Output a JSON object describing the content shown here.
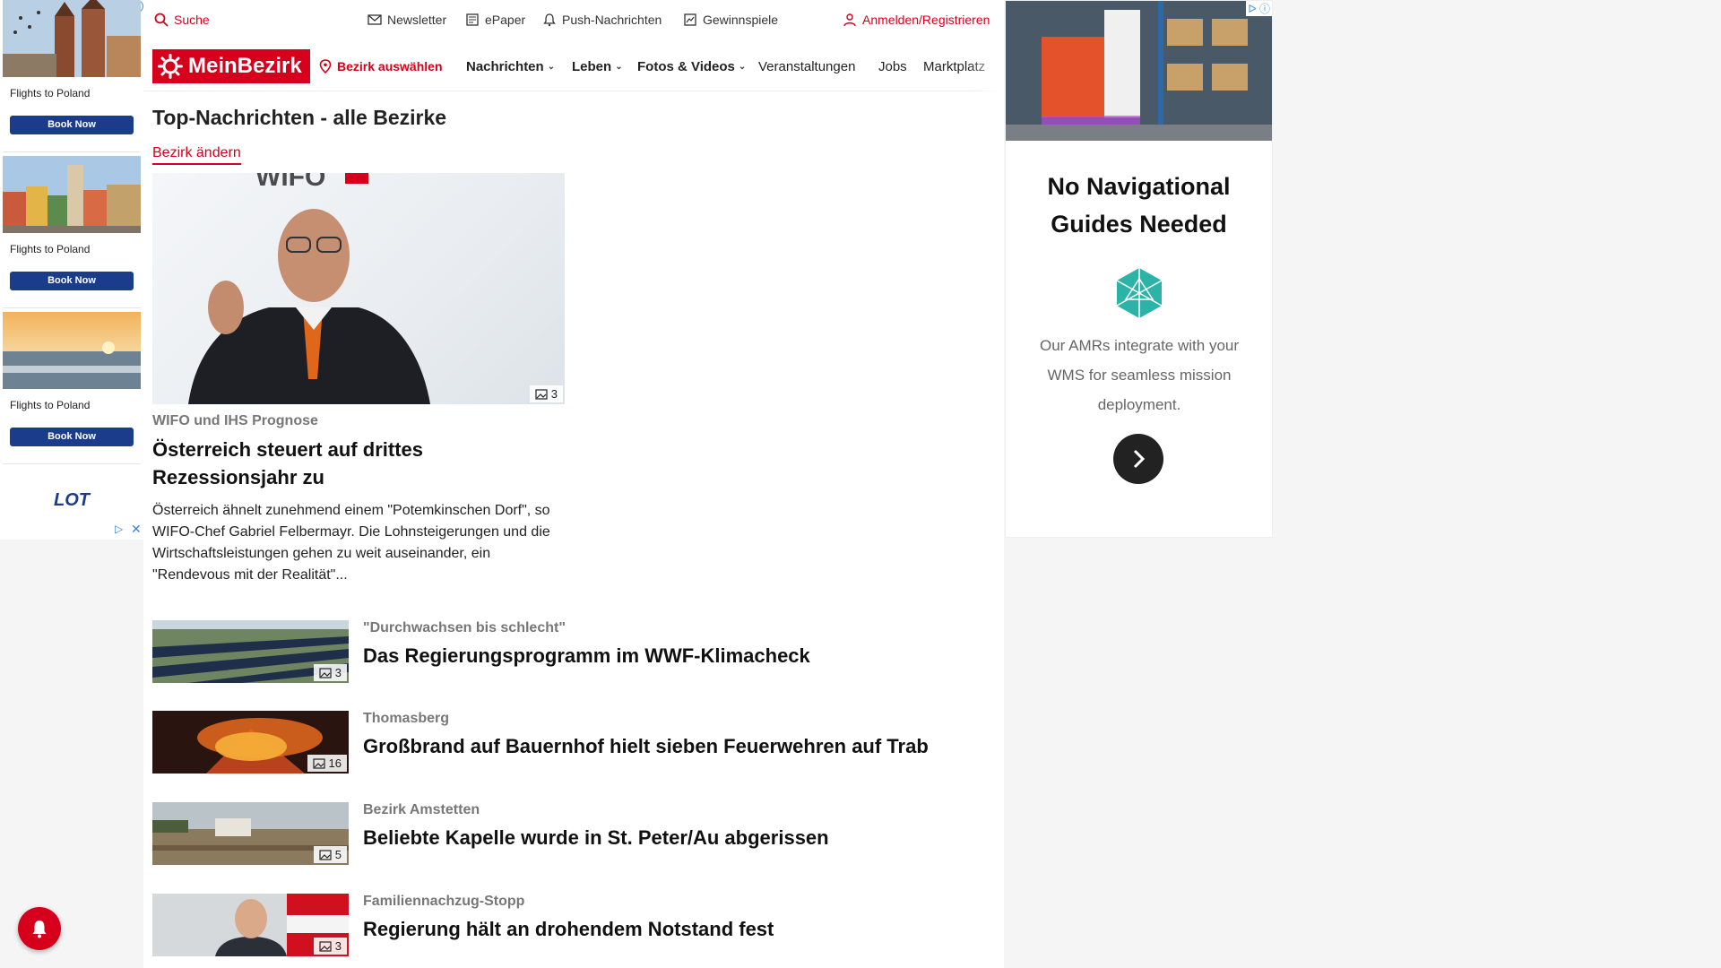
{
  "left_ad": {
    "cards": [
      {
        "caption": "Flights to Poland",
        "button": "Book Now"
      },
      {
        "caption": "Flights to Poland",
        "button": "Book Now"
      },
      {
        "caption": "Flights to Poland",
        "button": "Book Now"
      }
    ],
    "logo_text": "LOT",
    "info_mark": "i"
  },
  "utility": {
    "search": "Suche",
    "newsletter": "Newsletter",
    "epaper": "ePaper",
    "push": "Push-Nachrichten",
    "prizes": "Gewinnspiele",
    "login": "Anmelden/Registrieren"
  },
  "nav": {
    "brand": "MeinBezirk",
    "location": "Bezirk auswählen",
    "items": [
      {
        "label": "Nachrichten",
        "dropdown": true
      },
      {
        "label": "Leben",
        "dropdown": true
      },
      {
        "label": "Fotos & Videos",
        "dropdown": true
      },
      {
        "label": "Veranstaltungen",
        "dropdown": false
      },
      {
        "label": "Jobs",
        "dropdown": false
      },
      {
        "label": "Marktplatz",
        "dropdown": false
      }
    ]
  },
  "page": {
    "title": "Top-Nachrichten - alle Bezirke",
    "change_district": "Bezirk ändern"
  },
  "hero": {
    "image_count": "3",
    "kicker": "WIFO und IHS Prognose",
    "headline": "Österreich steuert auf drittes Rezessionsjahr zu",
    "teaser": "Österreich ähnelt zunehmend einem \"Potemkinschen Dorf\", so WIFO-Chef Gabriel Felbermayr. Die Lohnsteigerungen und die Wirtschaftsleistungen gehen zu weit auseinander, ein \"Rendevous mit der Realität\"..."
  },
  "articles": [
    {
      "kicker": "\"Durchwachsen bis schlecht\"",
      "headline": "Das Regierungsprogramm im WWF-Klimacheck",
      "image_count": "3"
    },
    {
      "kicker": "Thomasberg",
      "headline": "Großbrand auf Bauernhof hielt sieben Feuerwehren auf Trab",
      "image_count": "16"
    },
    {
      "kicker": "Bezirk Amstetten",
      "headline": "Beliebte Kapelle wurde in St. Peter/Au abgerissen",
      "image_count": "5"
    },
    {
      "kicker": "Familiennachzug-Stopp",
      "headline": "Regierung hält an drohendem Notstand fest",
      "image_count": "3"
    }
  ],
  "right_ad": {
    "heading": "No Navigational Guides Needed",
    "body": "Our AMRs integrate with your WMS for seamless mission deployment.",
    "marks": "ᐅ ⓘ"
  },
  "colors": {
    "brand_red": "#d6001c",
    "ad_button_blue": "#1a3c8a"
  }
}
